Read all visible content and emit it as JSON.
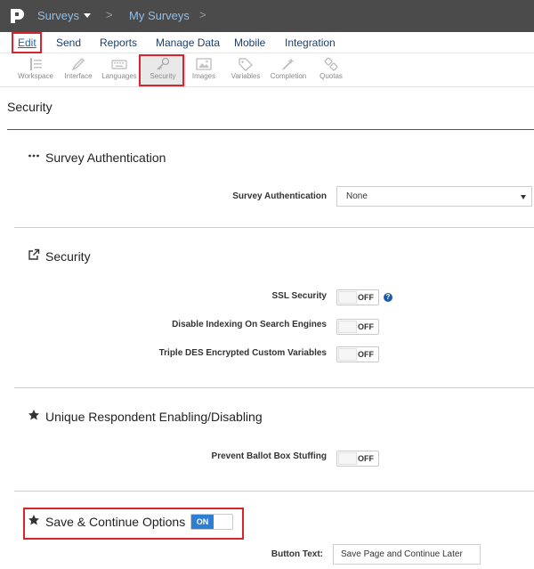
{
  "topbar": {
    "crumbs": [
      "Surveys",
      "My Surveys"
    ],
    "separator": ">"
  },
  "menu": {
    "items": [
      "Edit",
      "Send",
      "Reports",
      "Manage Data",
      "Mobile",
      "Integration"
    ],
    "active": "Edit"
  },
  "toolbar": {
    "items": [
      {
        "label": "Workspace",
        "icon": "workspace-icon"
      },
      {
        "label": "Interface",
        "icon": "pen-icon"
      },
      {
        "label": "Languages",
        "icon": "keyboard-icon"
      },
      {
        "label": "Security",
        "icon": "key-icon"
      },
      {
        "label": "Images",
        "icon": "image-icon"
      },
      {
        "label": "Variables",
        "icon": "tag-icon"
      },
      {
        "label": "Completion",
        "icon": "magic-wand-icon"
      },
      {
        "label": "Quotas",
        "icon": "quotas-icon"
      }
    ],
    "active": "Security"
  },
  "page": {
    "title": "Security"
  },
  "sections": {
    "auth": {
      "title": "Survey Authentication",
      "field_label": "Survey Authentication",
      "select_value": "None"
    },
    "security": {
      "title": "Security",
      "fields": [
        {
          "label": "SSL Security",
          "state": "OFF"
        },
        {
          "label": "Disable Indexing On Search Engines",
          "state": "OFF"
        },
        {
          "label": "Triple DES Encrypted Custom Variables",
          "state": "OFF"
        }
      ],
      "help": "?"
    },
    "unique": {
      "title": "Unique Respondent Enabling/Disabling",
      "fields": [
        {
          "label": "Prevent Ballot Box Stuffing",
          "state": "OFF"
        }
      ]
    },
    "save": {
      "title": "Save & Continue Options",
      "toggle_state": "ON",
      "button_text_label": "Button Text:",
      "button_text_value": "Save Page and Continue Later"
    }
  },
  "colors": {
    "highlight": "#d9232f",
    "topbar": "#4b4b4b",
    "accent": "#2d7fd3"
  }
}
